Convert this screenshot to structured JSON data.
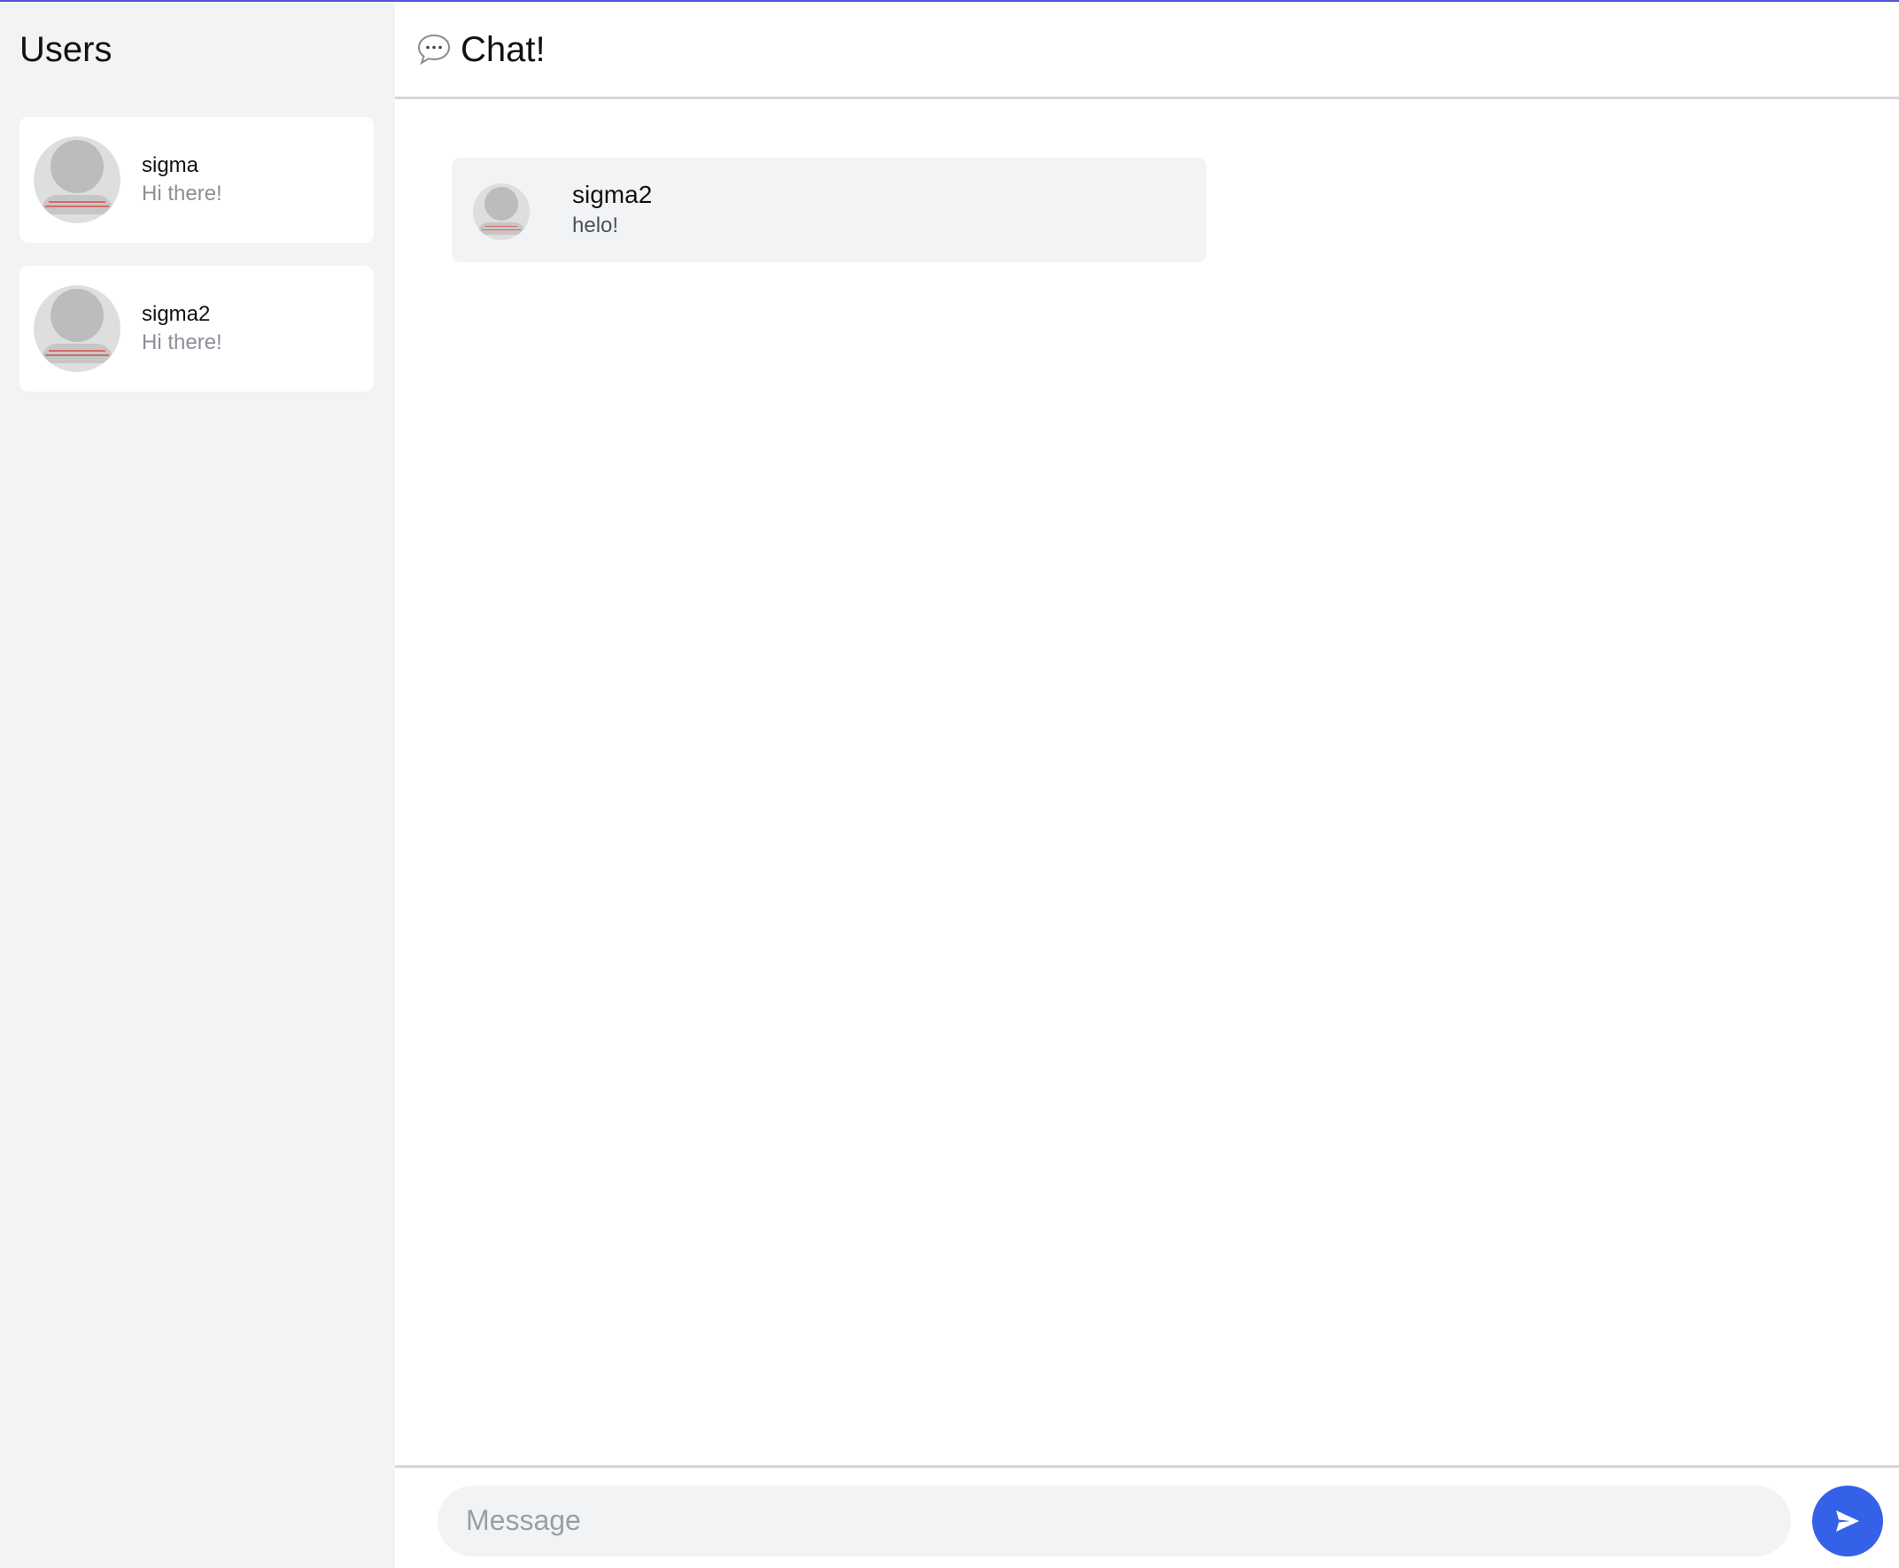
{
  "sidebar": {
    "title": "Users",
    "users": [
      {
        "name": "sigma",
        "preview": "Hi there!"
      },
      {
        "name": "sigma2",
        "preview": "Hi there!"
      }
    ]
  },
  "header": {
    "icon": "speech-bubble-icon",
    "title": "Chat!"
  },
  "messages": [
    {
      "author": "sigma2",
      "body": "helo!"
    }
  ],
  "composer": {
    "placeholder": "Message",
    "value": "",
    "send_icon": "send-icon"
  },
  "colors": {
    "accent": "#3461e8",
    "top_border": "#5553d6",
    "sidebar_bg": "#f2f3f5",
    "preview_text": "#8b8f96"
  }
}
